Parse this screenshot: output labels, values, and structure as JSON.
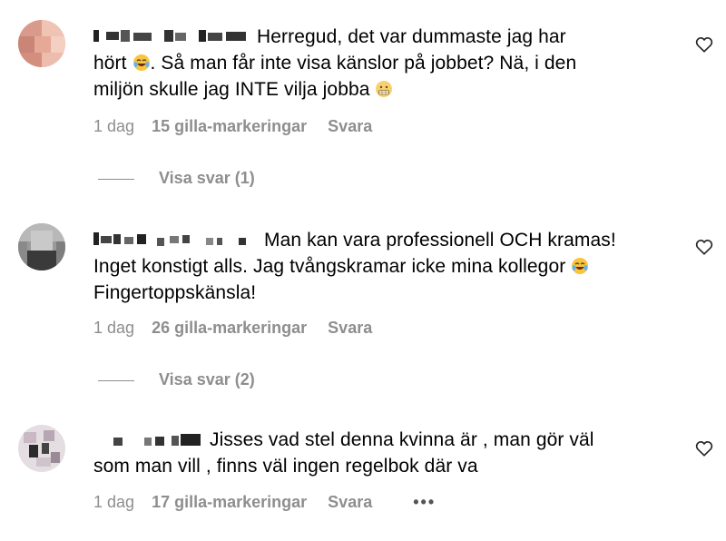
{
  "comments": [
    {
      "text_line1": "Herregud, det var dummaste jag har",
      "text_line2a": "hört",
      "text_line2b": ". Så man får inte visa känslor på jobbet? Nä, i den",
      "text_line3a": "miljön skulle jag INTE vilja jobba",
      "date": "1 dag",
      "likes": "15 gilla-markeringar",
      "reply": "Svara",
      "view_replies": "Visa svar (1)",
      "emoji_1": "laughing-tears-emoji",
      "emoji_2": "grimacing-face-emoji"
    },
    {
      "text_line1": "Man kan vara professionell OCH kramas!",
      "text_line2a": "Inget konstigt alls. Jag tvångskramar icke mina kollegor",
      "text_line3a": "Fingertoppskänsla!",
      "date": "1 dag",
      "likes": "26 gilla-markeringar",
      "reply": "Svara",
      "view_replies": "Visa svar (2)",
      "emoji_1": "laughing-tears-emoji"
    },
    {
      "text_line1": "Jisses vad stel denna kvinna är , man gör väl",
      "text_line2a": "som man vill , finns väl ingen regelbok där va",
      "date": "1 dag",
      "likes": "17 gilla-markeringar",
      "reply": "Svara",
      "more": "•••"
    }
  ],
  "icons": {
    "like": "heart-outline-icon",
    "more": "more-options-icon"
  },
  "colors": {
    "meta_gray": "#8e8e8e",
    "text": "#000000",
    "background": "#ffffff"
  }
}
